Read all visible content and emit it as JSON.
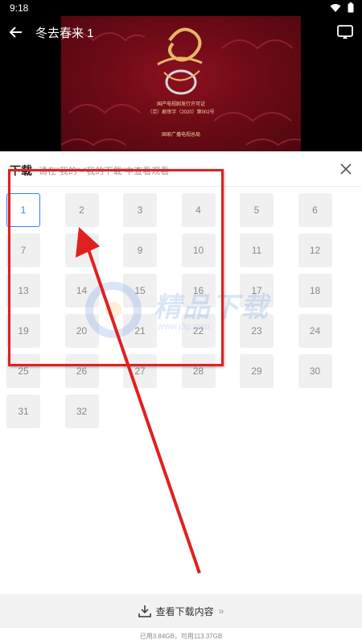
{
  "status_bar": {
    "time": "9:18"
  },
  "player": {
    "title": "冬去春来 1",
    "art_lines": [
      "国产电视剧发行许可证",
      "（京）剧审字（2020）第002号",
      "国家广播电视总局"
    ]
  },
  "panel": {
    "title": "下载",
    "hint": "请在\"我的\"-\"我的下载\"中查看观看"
  },
  "episodes": [
    "1",
    "2",
    "3",
    "4",
    "5",
    "6",
    "7",
    "8",
    "9",
    "10",
    "11",
    "12",
    "13",
    "14",
    "15",
    "16",
    "17",
    "18",
    "19",
    "20",
    "21",
    "22",
    "23",
    "24",
    "25",
    "26",
    "27",
    "28",
    "29",
    "30",
    "31",
    "32"
  ],
  "selected_episode": "1",
  "watermark": {
    "text": "精品下载",
    "url": "www.j3p.com"
  },
  "footer": {
    "view_downloads": "查看下载内容",
    "storage": "已用3.84GB，可用113.37GB"
  },
  "colors": {
    "accent": "#3b7bff",
    "annotation": "#e02020"
  }
}
